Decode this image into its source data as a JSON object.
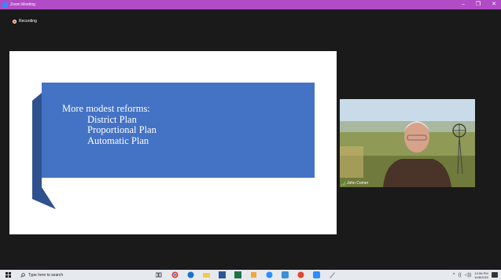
{
  "window": {
    "title": "Zoom Meeting",
    "controls": {
      "minimize": "–",
      "maximize": "❐",
      "close": "✕"
    }
  },
  "recording": {
    "label": "Recording"
  },
  "shared_slide": {
    "heading": "More modest reforms:",
    "items": [
      "District Plan",
      "Proportional Plan",
      "Automatic Plan"
    ],
    "colors": {
      "ribbon": "#4472c4",
      "ribbon_fold": "#2f528f",
      "background": "#ffffff"
    }
  },
  "participant": {
    "name": "John Comer"
  },
  "taskbar": {
    "search_placeholder": "Type here to search",
    "pinned_apps": [
      "task-view",
      "chrome",
      "edge",
      "file-explorer",
      "word",
      "excel",
      "people",
      "media",
      "teams",
      "chrome-alt",
      "zoom",
      "paint"
    ],
    "tray": {
      "chevron": "^",
      "network": "((",
      "volume": "◁))",
      "time": "12:56 PM",
      "date": "10/8/2020"
    }
  }
}
